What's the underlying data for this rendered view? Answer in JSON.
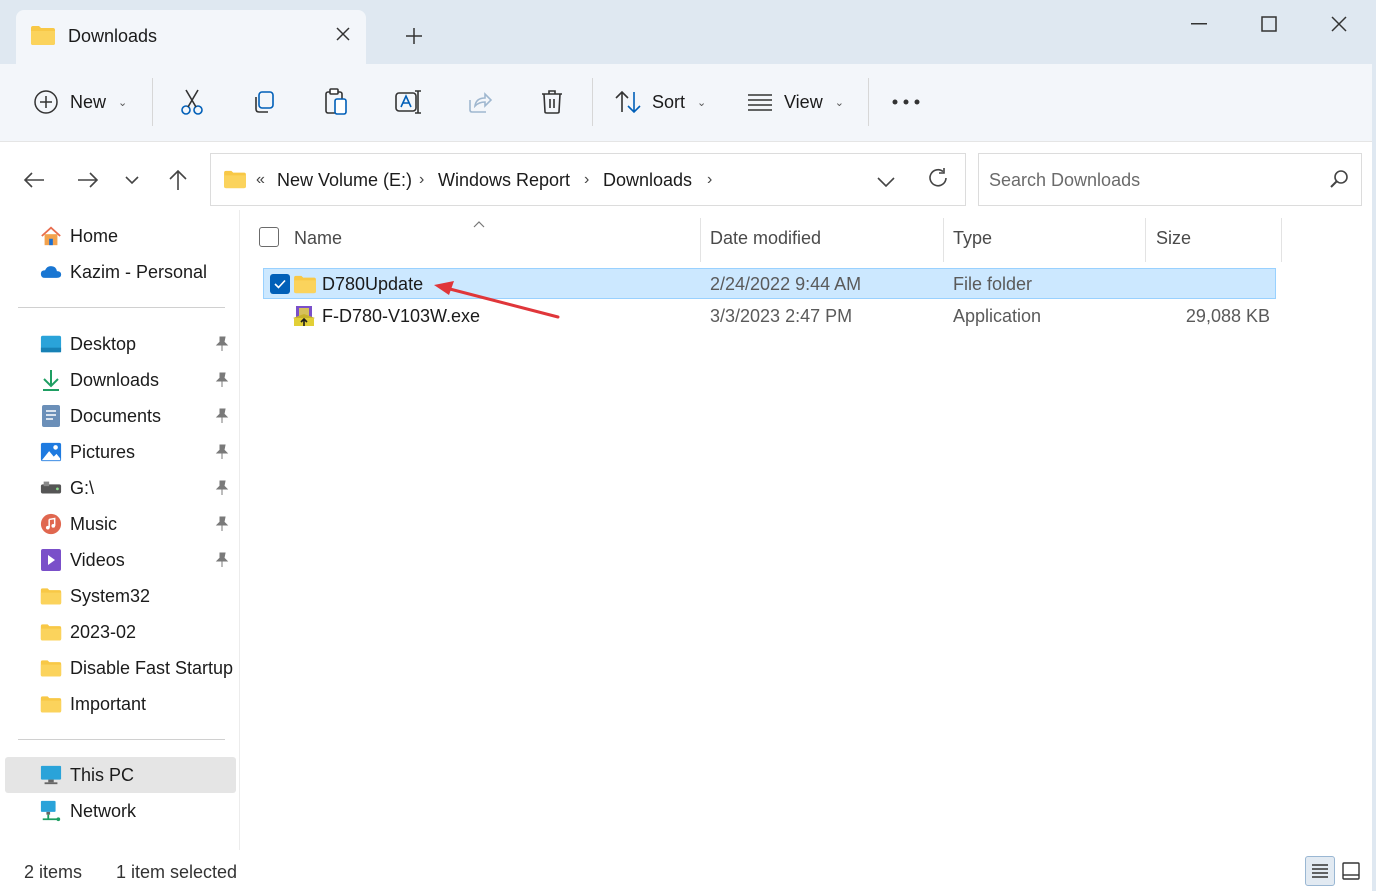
{
  "window": {
    "tab_title": "Downloads",
    "colors": {
      "titlebar": "#dfe8f1",
      "accent": "#005fb8",
      "selection": "#cce8ff",
      "folder": "#f8c846",
      "arrow": "#e0363a"
    }
  },
  "toolbar": {
    "new_label": "New",
    "sort_label": "Sort",
    "view_label": "View",
    "icons": [
      "cut-icon",
      "copy-icon",
      "paste-icon",
      "rename-icon",
      "share-icon",
      "delete-icon",
      "more-icon"
    ]
  },
  "address": {
    "overflow": "«",
    "crumbs": [
      "New Volume (E:)",
      "Windows Report",
      "Downloads"
    ]
  },
  "search": {
    "placeholder": "Search Downloads"
  },
  "nav": {
    "top": [
      {
        "label": "Home",
        "icon": "home-icon"
      },
      {
        "label": "Kazim - Personal",
        "icon": "onedrive-icon"
      }
    ],
    "pinned": [
      {
        "label": "Desktop",
        "icon": "desktop-icon"
      },
      {
        "label": "Downloads",
        "icon": "downloads-icon"
      },
      {
        "label": "Documents",
        "icon": "documents-icon"
      },
      {
        "label": "Pictures",
        "icon": "pictures-icon"
      },
      {
        "label": "G:\\",
        "icon": "drive-icon"
      },
      {
        "label": "Music",
        "icon": "music-icon"
      },
      {
        "label": "Videos",
        "icon": "videos-icon"
      },
      {
        "label": "System32",
        "icon": "folder-icon"
      },
      {
        "label": "2023-02",
        "icon": "folder-icon"
      },
      {
        "label": "Disable Fast Startup",
        "icon": "folder-icon"
      },
      {
        "label": "Important",
        "icon": "folder-icon"
      }
    ],
    "bottom": [
      {
        "label": "This PC",
        "icon": "this-pc-icon"
      },
      {
        "label": "Network",
        "icon": "network-icon"
      }
    ]
  },
  "columns": [
    "Name",
    "Date modified",
    "Type",
    "Size"
  ],
  "files": [
    {
      "name": "D780Update",
      "date": "2/24/2022 9:44 AM",
      "type": "File folder",
      "size": "",
      "selected": true
    },
    {
      "name": "F-D780-V103W.exe",
      "date": "3/3/2023 2:47 PM",
      "type": "Application",
      "size": "29,088 KB",
      "selected": false
    }
  ],
  "status": {
    "count": "2 items",
    "selection": "1 item selected"
  }
}
